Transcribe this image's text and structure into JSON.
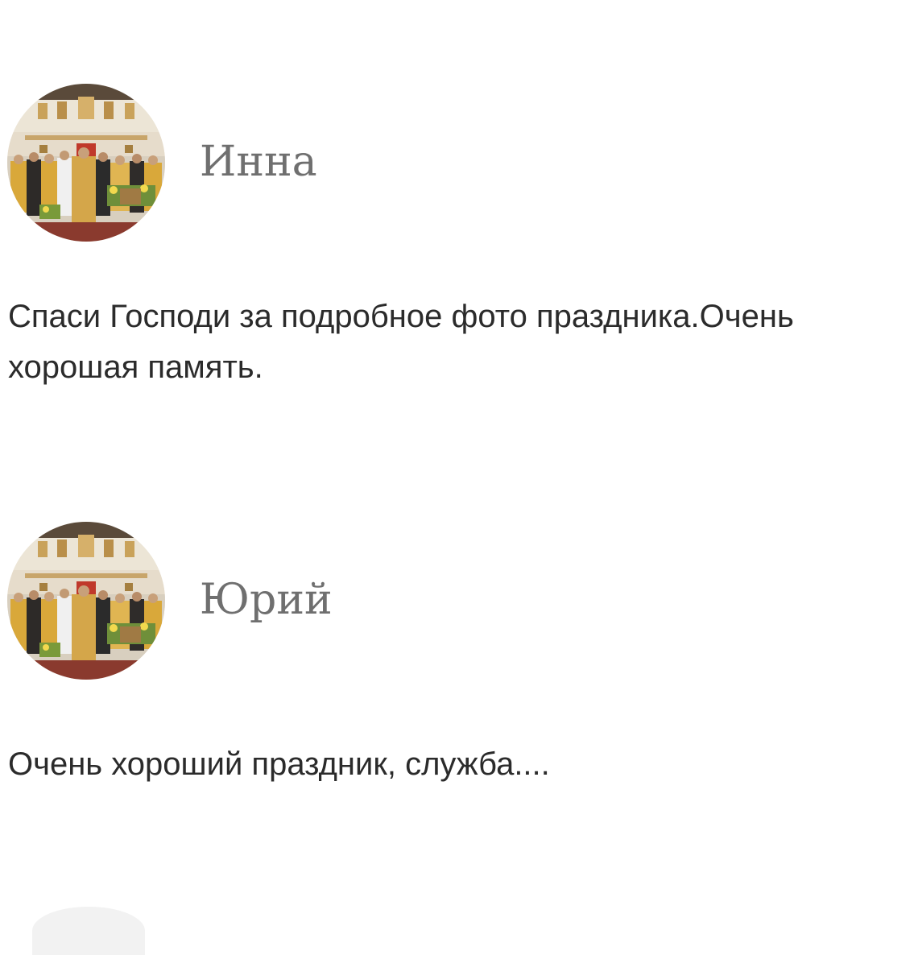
{
  "comments": [
    {
      "author": "Инна",
      "avatar_icon": "avatar-photo",
      "text": "Спаси Господи за подробное фото праздника.Очень хорошая память."
    },
    {
      "author": "Юрий",
      "avatar_icon": "avatar-photo",
      "text": "Очень хороший праздник, служба...."
    }
  ],
  "colors": {
    "author_text": "#6f6f6f",
    "body_text": "#2b2b2b",
    "background": "#ffffff",
    "vestment_gold": "#d9a83a"
  }
}
